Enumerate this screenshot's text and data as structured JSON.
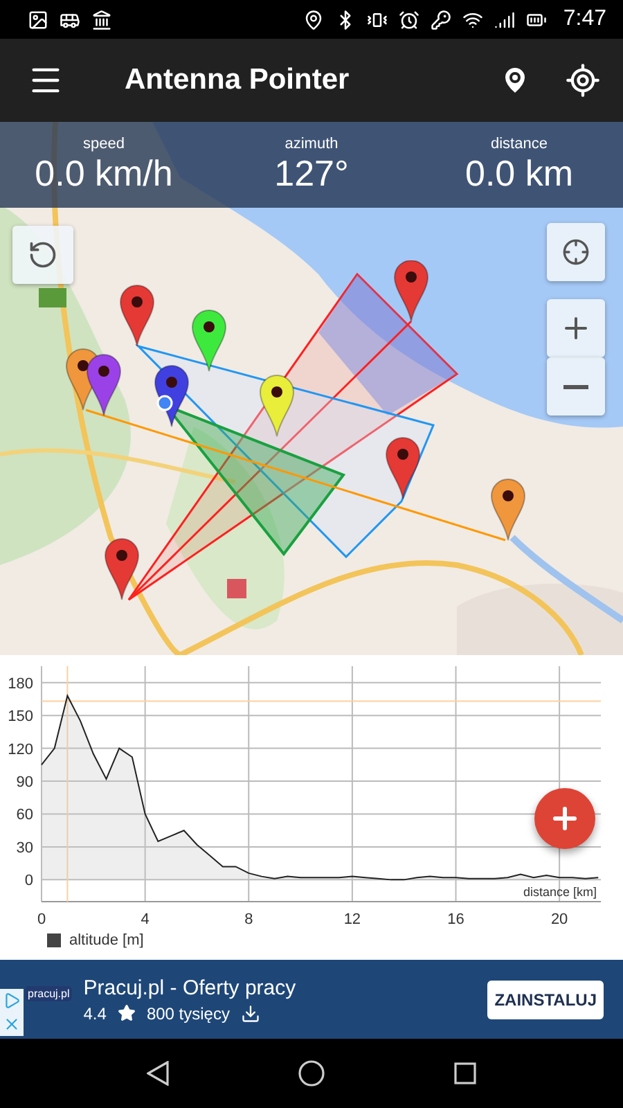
{
  "status_bar": {
    "time": "7:47"
  },
  "toolbar": {
    "title": "Antenna Pointer"
  },
  "readouts": [
    {
      "label": "speed",
      "value": "0.0 km/h"
    },
    {
      "label": "azimuth",
      "value": "127°"
    },
    {
      "label": "distance",
      "value": "0.0 km"
    }
  ],
  "chart": {
    "chart_data": {
      "type": "area",
      "xlabel": "distance [km]",
      "x": [
        0,
        0.5,
        1,
        1.5,
        2,
        2.5,
        3,
        3.5,
        4,
        4.5,
        5,
        5.5,
        6,
        6.5,
        7,
        7.5,
        8,
        8.5,
        9,
        9.5,
        10,
        10.5,
        11,
        11.5,
        12,
        12.5,
        13,
        13.5,
        14,
        14.5,
        15,
        15.5,
        16,
        16.5,
        17,
        17.5,
        18,
        18.5,
        19,
        19.5,
        20,
        20.5,
        21,
        21.5
      ],
      "series": [
        {
          "name": "altitude [m]",
          "color": "#222222",
          "values": [
            105,
            120,
            168,
            145,
            115,
            92,
            120,
            112,
            60,
            35,
            40,
            45,
            32,
            22,
            12,
            12,
            6,
            3,
            1,
            3,
            2,
            2,
            2,
            2,
            3,
            2,
            1,
            0,
            0,
            2,
            3,
            2,
            2,
            1,
            1,
            1,
            2,
            5,
            2,
            4,
            2,
            2,
            1,
            2
          ]
        }
      ],
      "xlim": [
        0,
        21.6
      ],
      "ylim": [
        -20,
        195
      ],
      "xticks": [
        0,
        4,
        8,
        12,
        16,
        20
      ],
      "yticks": [
        0,
        30,
        60,
        90,
        120,
        150,
        180
      ],
      "grid": true,
      "ref_lines": [
        {
          "axis": "x",
          "value": 1
        },
        {
          "axis": "y",
          "value": 163
        }
      ]
    }
  },
  "ad": {
    "logo": "pracuj.pl",
    "title": "Pracuj.pl - Oferty pracy",
    "rating": "4.4",
    "downloads": "800 tysięcy",
    "button": "ZAINSTALUJ"
  }
}
